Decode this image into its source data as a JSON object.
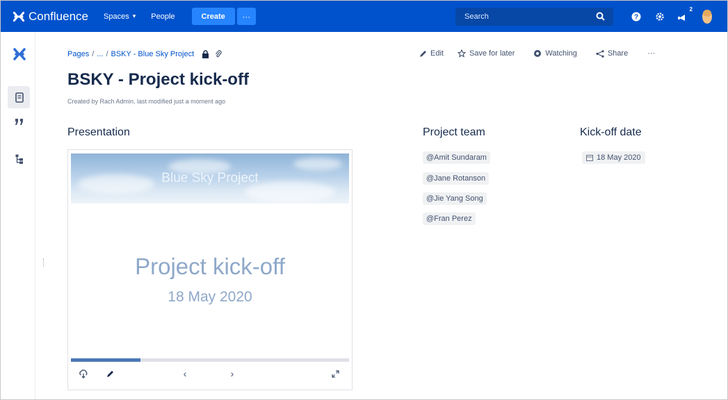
{
  "nav": {
    "product_name": "Confluence",
    "spaces_label": "Spaces",
    "people_label": "People",
    "create_label": "Create",
    "more_label": "···",
    "search_placeholder": "Search",
    "notification_count": "2",
    "brand_color": "#0052cc"
  },
  "breadcrumb": {
    "pages": "Pages",
    "ellipsis": "...",
    "space": "BSKY - Blue Sky Project"
  },
  "actions": {
    "edit": "Edit",
    "save_for_later": "Save for later",
    "watching": "Watching",
    "share": "Share",
    "more": "···"
  },
  "page": {
    "title": "BSKY - Project kick-off",
    "meta": "Created by Rach Admin, last modified just a moment ago"
  },
  "sections": {
    "presentation": "Presentation",
    "project_team": "Project team",
    "kickoff_date": "Kick-off date"
  },
  "team": [
    {
      "name": "@Amit Sundaram"
    },
    {
      "name": "@Jane Rotanson"
    },
    {
      "name": "@Jie Yang Song"
    },
    {
      "name": "@Fran Perez"
    }
  ],
  "kickoff": {
    "date": "18 May 2020"
  },
  "slide": {
    "banner": "Blue Sky Project",
    "title": "Project kick-off",
    "date": "18 May 2020",
    "progress_fraction": 0.25
  }
}
